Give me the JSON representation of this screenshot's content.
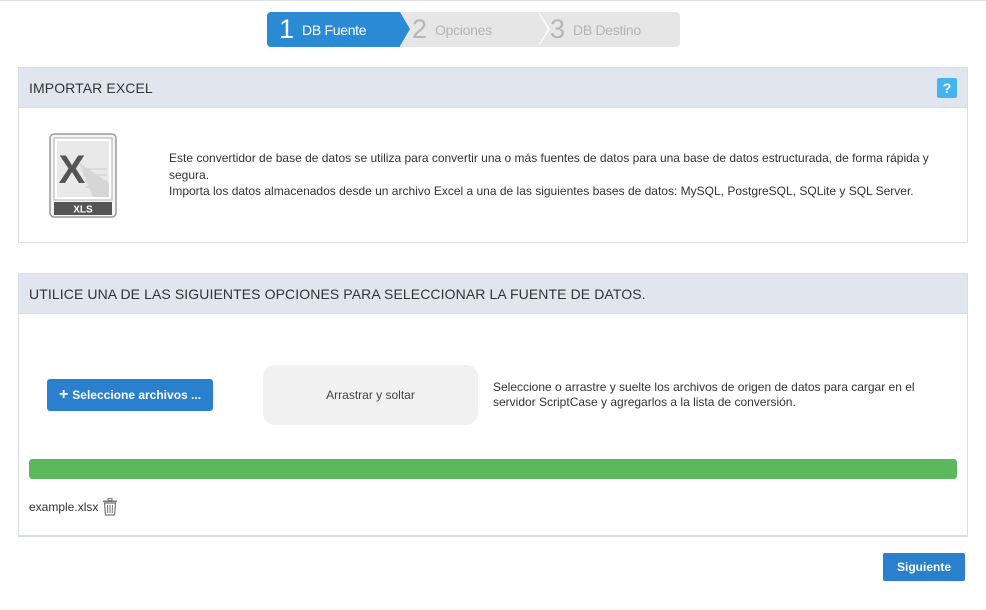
{
  "stepper": {
    "steps": [
      {
        "number": "1",
        "label": "DB Fuente",
        "state": "active"
      },
      {
        "number": "2",
        "label": "Opciones",
        "state": "inactive"
      },
      {
        "number": "3",
        "label": "DB Destino",
        "state": "inactive"
      }
    ]
  },
  "import_panel": {
    "title": "IMPORTAR EXCEL",
    "help_label": "?",
    "file_icon_label": "XLS",
    "description_line1": "Este convertidor de base de datos se utiliza para convertir una o más fuentes de datos para una base de datos estructurada, de forma rápida y segura.",
    "description_line2": "Importa los datos almacenados desde un archivo Excel a una de las siguientes bases de datos: MySQL, PostgreSQL, SQLite y SQL Server."
  },
  "source_panel": {
    "title": "UTILICE UNA DE LAS SIGUIENTES OPCIONES PARA SELECCIONAR LA FUENTE DE DATOS.",
    "select_button_icon": "+",
    "select_button_label": "Seleccione archivos ...",
    "dropzone_label": "Arrastrar y soltar",
    "upload_note": "Seleccione o arrastre y suelte los archivos de origen de datos para cargar en el servidor ScriptCase y agregarlos a la lista de conversión.",
    "progress_percent": 100,
    "files": [
      {
        "name": "example.xlsx",
        "icon": "trash-icon"
      }
    ]
  },
  "footer": {
    "next_label": "Siguiente"
  },
  "colors": {
    "accent": "#2a80cc",
    "step_active": "#2a8ad4",
    "progress": "#5cb85c",
    "header_bg": "#e1e6ee",
    "help": "#43b4f0"
  }
}
